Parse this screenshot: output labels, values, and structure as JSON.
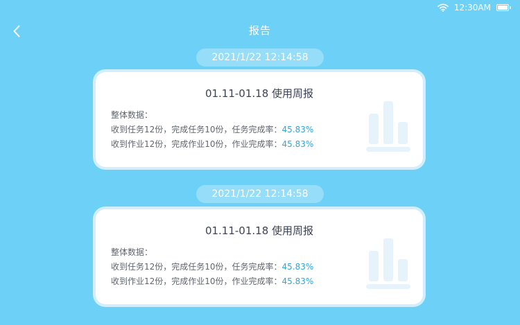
{
  "status": {
    "time": "12:30AM"
  },
  "header": {
    "title": "报告"
  },
  "reports": [
    {
      "timestamp": "2021/1/22 12:14:58",
      "title": "01.11-01.18 使用周报",
      "overall_label": "整体数据：",
      "task_line": "收到任务12份，完成任务10份，任务完成率：",
      "task_rate": "45.83%",
      "homework_line": "收到作业12份，完成作业10份，作业完成率：",
      "homework_rate": "45.83%"
    },
    {
      "timestamp": "2021/1/22 12:14:58",
      "title": "01.11-01.18 使用周报",
      "overall_label": "整体数据：",
      "task_line": "收到任务12份，完成任务10份，任务完成率：",
      "task_rate": "45.83%",
      "homework_line": "收到作业12份，完成作业10份，作业完成率：",
      "homework_rate": "45.83%"
    }
  ],
  "colors": {
    "background": "#6cd0f7",
    "accent": "#2ba7dd",
    "card": "#ffffff"
  },
  "icons": {
    "back": "chevron-left-icon",
    "wifi": "wifi-icon",
    "battery": "battery-icon",
    "report_chart": "bar-chart-icon"
  }
}
